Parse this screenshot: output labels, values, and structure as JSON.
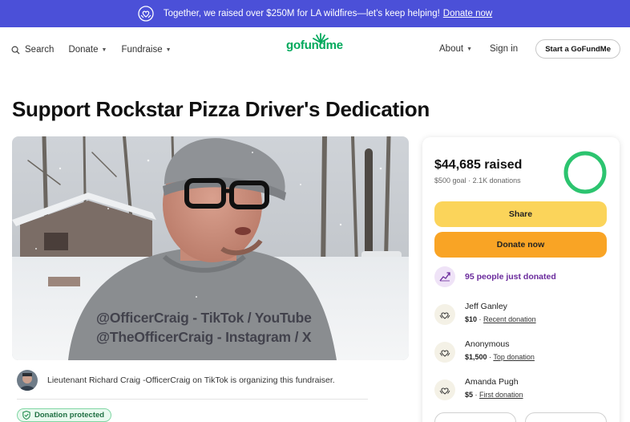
{
  "banner": {
    "text": "Together, we raised over $250M for LA wildfires—let’s keep helping!",
    "link": "Donate now"
  },
  "nav": {
    "search": "Search",
    "donate": "Donate",
    "fundraise": "Fundraise",
    "logo": "gofundme",
    "about": "About",
    "signin": "Sign in",
    "start": "Start a GoFundMe"
  },
  "campaign": {
    "title": "Support Rockstar Pizza Driver's Dedication",
    "overlay_line1": "@OfficerCraig - TikTok / YouTube",
    "overlay_line2": "@TheOfficerCraig - Instagram / X",
    "organizer_text": "Lieutenant Richard Craig -OfficerCraig on TikTok is organizing this fundraiser.",
    "protected": "Donation protected"
  },
  "donation_card": {
    "raised": "$44,685 raised",
    "goal": "$500 goal",
    "donations": "2.1K donations",
    "progress_fraction": 1.0,
    "share": "Share",
    "donate": "Donate now",
    "trend": "95 people just donated",
    "donors": [
      {
        "name": "Jeff Ganley",
        "amount": "$10",
        "tag": "Recent donation"
      },
      {
        "name": "Anonymous",
        "amount": "$1,500",
        "tag": "Top donation"
      },
      {
        "name": "Amanda Pugh",
        "amount": "$5",
        "tag": "First donation"
      }
    ]
  },
  "colors": {
    "banner": "#4b50d8",
    "brand_green": "#02a95c",
    "share_button": "#fbd45a",
    "donate_button": "#f9a425",
    "trend_purple": "#6a2a9c"
  },
  "icons": {
    "banner": "heart-hands-icon",
    "search": "search-icon",
    "trend": "trending-up-icon",
    "donor": "donor-heart-icon",
    "protected": "shield-check-icon"
  }
}
